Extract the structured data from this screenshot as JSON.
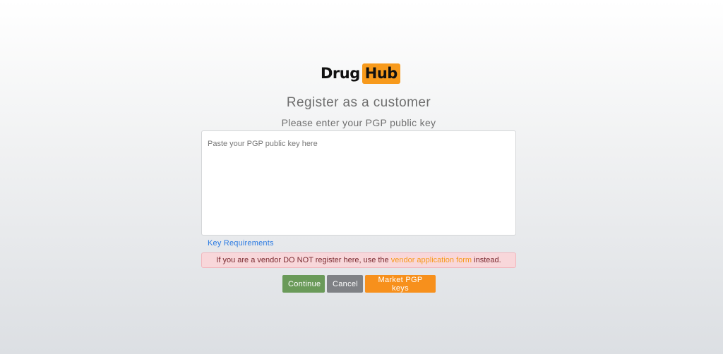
{
  "logo": {
    "text": "Drug",
    "highlight": "Hub",
    "highlight_color": "#f79a1c"
  },
  "header": {
    "title": "Register as a customer",
    "subtitle": "Please enter your PGP public key"
  },
  "form": {
    "pgp_placeholder": "Paste your PGP public key here",
    "pgp_value": "",
    "key_requirements_link": "Key Requirements"
  },
  "alert": {
    "text_before": "If you are a vendor DO NOT register here, use the ",
    "link_text": "vendor application form",
    "text_after": " instead.",
    "background_color": "#f8d7da"
  },
  "buttons": {
    "continue_label": "Continue",
    "continue_color": "#6a9a59",
    "cancel_label": "Cancel",
    "cancel_color": "#7f8185",
    "market_pgp_label": "Market PGP keys",
    "market_pgp_color": "#f7901c"
  }
}
